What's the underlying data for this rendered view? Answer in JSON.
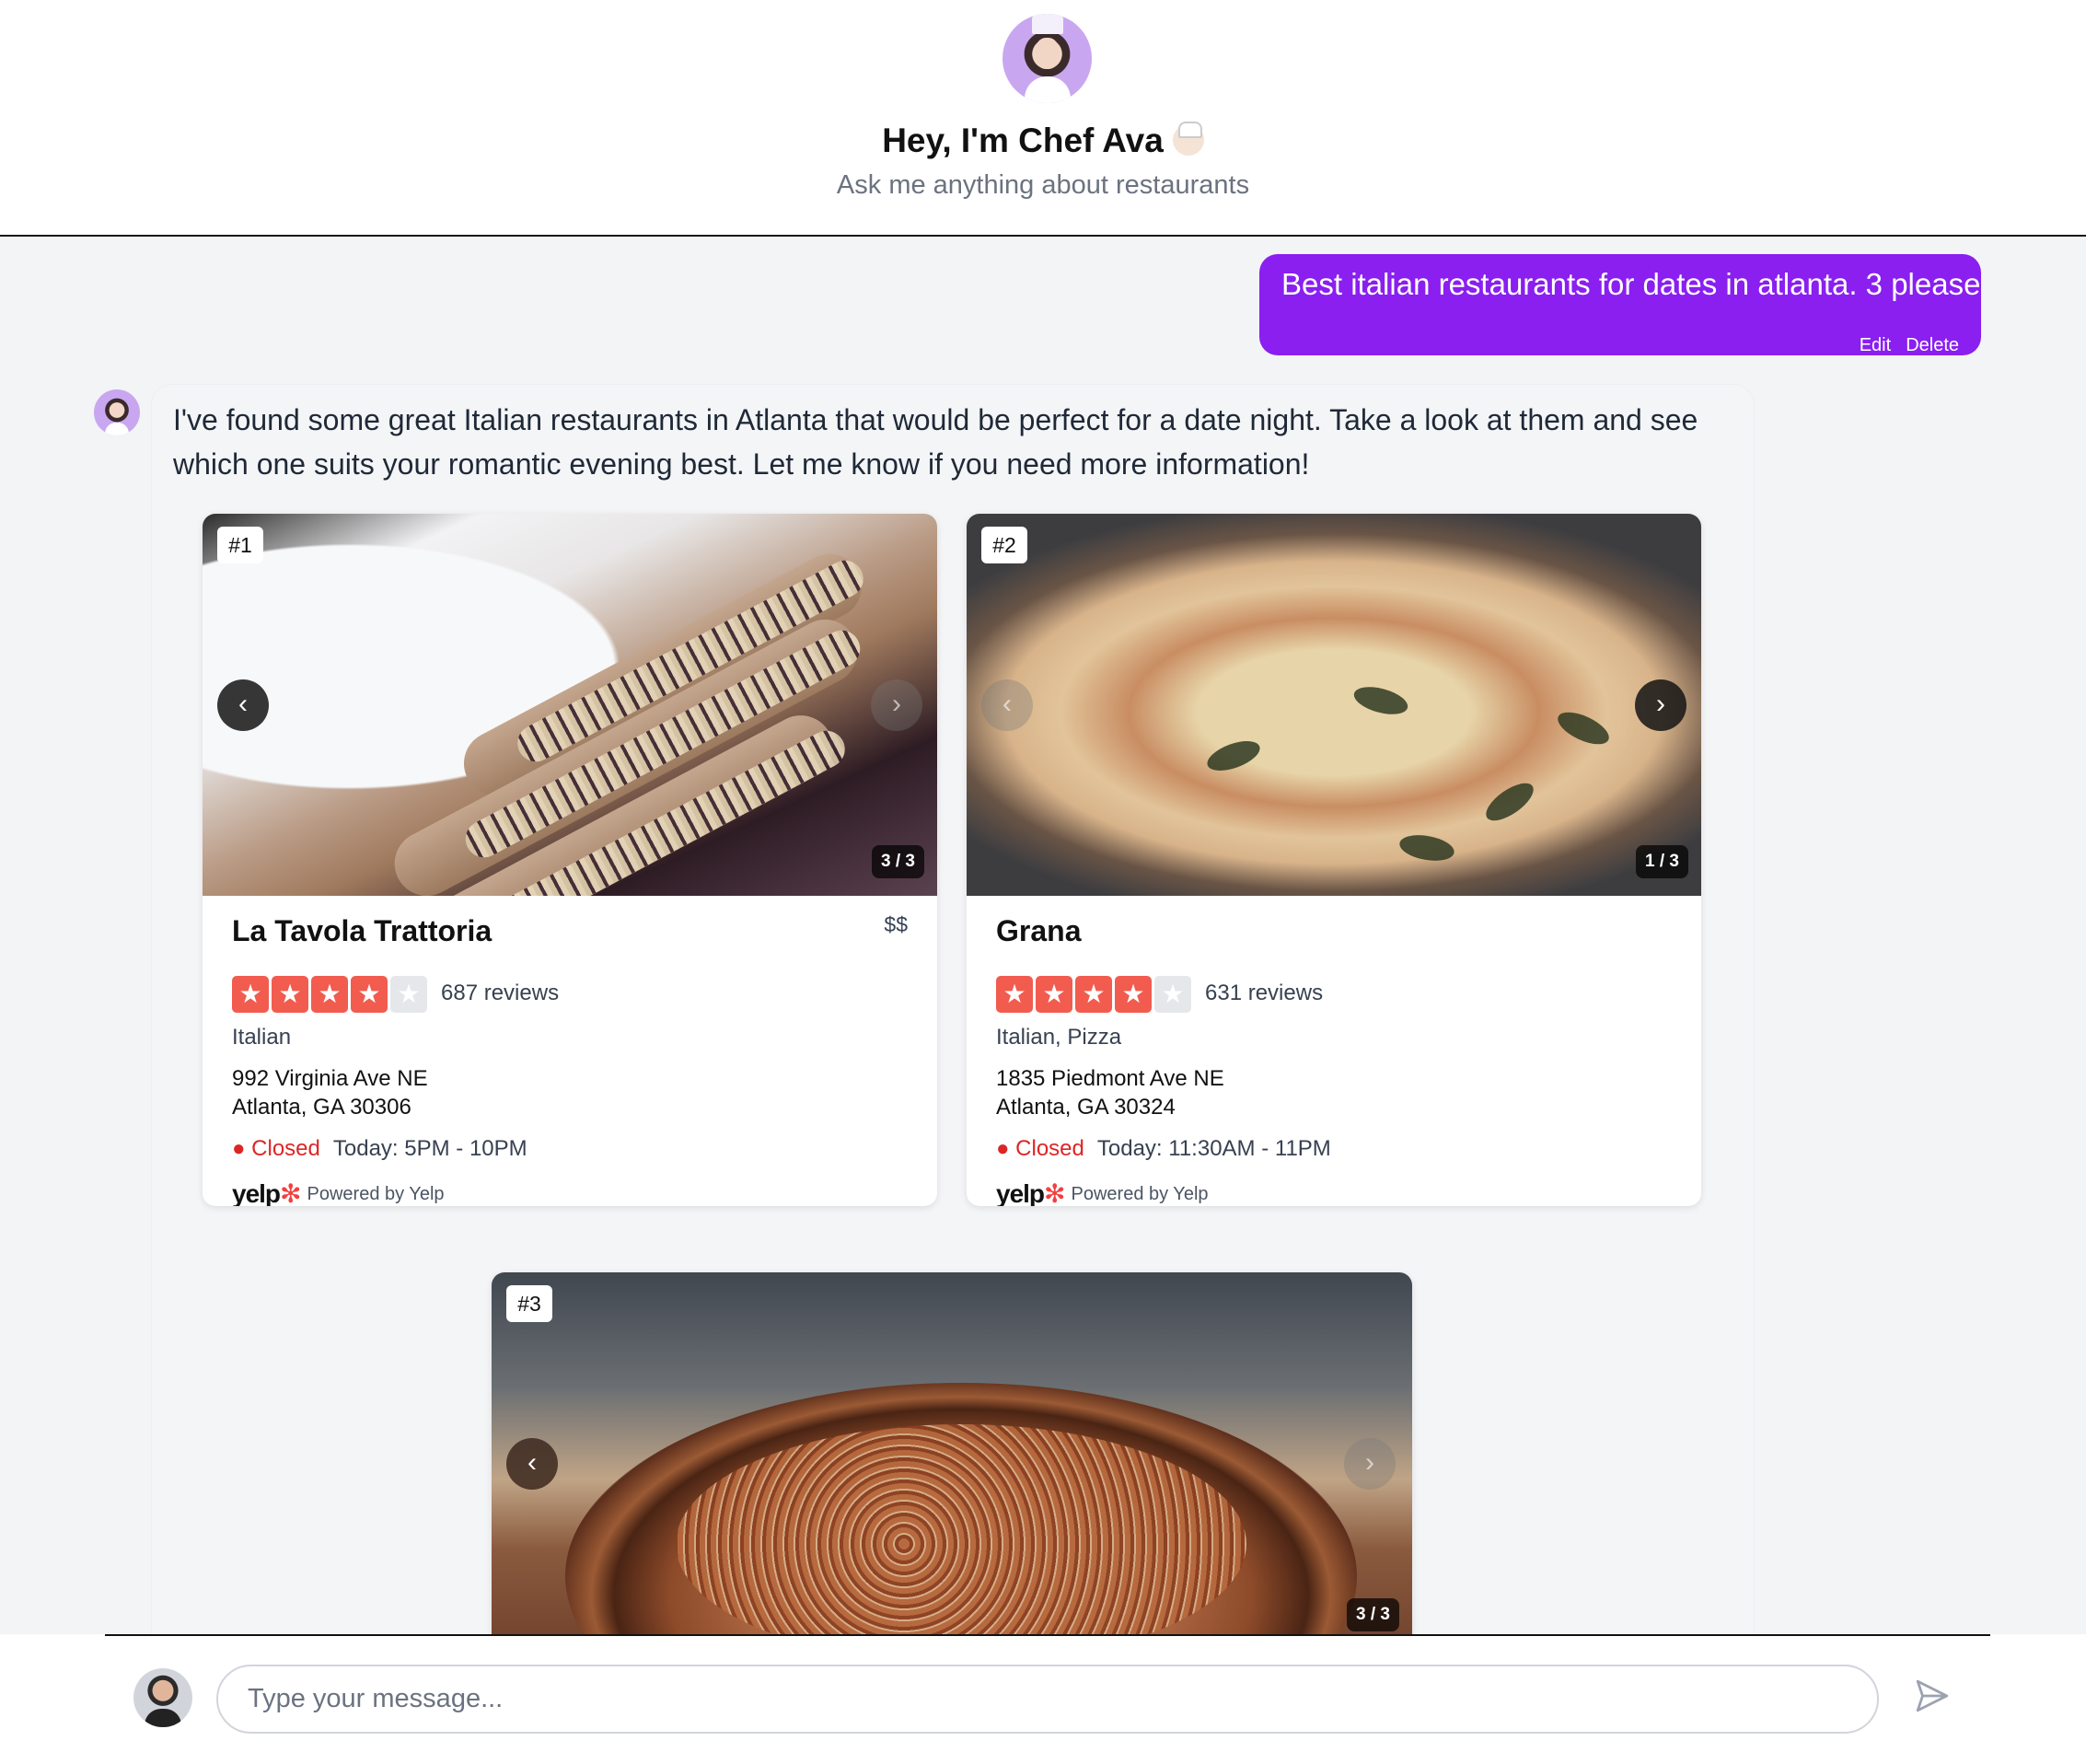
{
  "header": {
    "title": "Hey, I'm Chef Ava",
    "subtitle": "Ask me anything about restaurants"
  },
  "user_message": {
    "text": "Best italian restaurants for dates in atlanta. 3 please",
    "edit_label": "Edit",
    "delete_label": "Delete"
  },
  "bot_message": {
    "text": "I've found some great Italian restaurants in Atlanta that would be perfect for a date night. Take a look at them and see which one suits your romantic evening best. Let me know if you need more information!"
  },
  "restaurants": [
    {
      "rank": "#1",
      "name": "La Tavola Trattoria",
      "price": "$$",
      "rating": 4,
      "reviews": "687 reviews",
      "category": "Italian",
      "address_line1": "992 Virginia Ave NE",
      "address_line2": "Atlanta, GA 30306",
      "status": "Closed",
      "hours": "Today: 5PM - 10PM",
      "photo_counter": "3 / 3",
      "yelp_logo": "yelp",
      "powered_by": "Powered by Yelp"
    },
    {
      "rank": "#2",
      "name": "Grana",
      "price": "",
      "rating": 4,
      "reviews": "631 reviews",
      "category": "Italian, Pizza",
      "address_line1": "1835 Piedmont Ave NE",
      "address_line2": "Atlanta, GA 30324",
      "status": "Closed",
      "hours": "Today: 11:30AM - 11PM",
      "photo_counter": "1 / 3",
      "yelp_logo": "yelp",
      "powered_by": "Powered by Yelp"
    },
    {
      "rank": "#3",
      "photo_counter": "3 / 3"
    }
  ],
  "input": {
    "placeholder": "Type your message..."
  },
  "icons": {
    "prev": "chevron-left-icon",
    "next": "chevron-right-icon",
    "send": "send-icon"
  },
  "colors": {
    "accent": "#8a1ff0",
    "star": "#f15c4f",
    "closed": "#dc2626"
  }
}
